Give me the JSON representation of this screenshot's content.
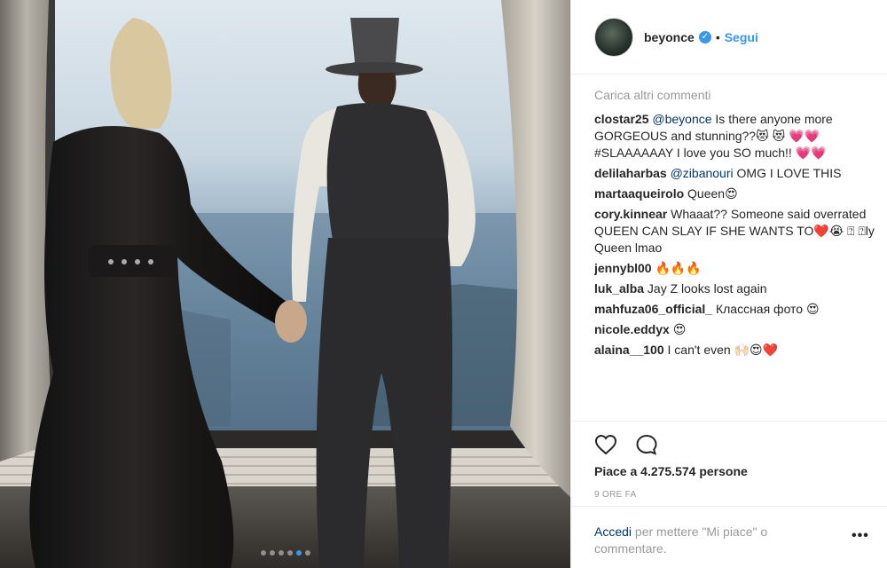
{
  "post": {
    "username": "beyonce",
    "separator": "•",
    "follow_label": "Segui",
    "load_more": "Carica altri commenti",
    "comments": [
      {
        "user": "clostar25",
        "mention": "@beyonce",
        "text": " Is there anyone more GORGEOUS and stunning??😻 😻 💗💗 #SLAAAAAAY I love you SO much!! 💗💗"
      },
      {
        "user": "delilaharbas",
        "mention": "@zibanouri",
        "text": " OMG I LOVE THIS"
      },
      {
        "user": "martaaqueirolo",
        "mention": "",
        "text": "Queen😍"
      },
      {
        "user": "cory.kinnear",
        "mention": "",
        "text": "Whaaat?? Someone said overrated QUEEN CAN SLAY IF SHE WANTS TO❤️😭 ⍰ ⍰ly Queen lmao"
      },
      {
        "user": "jennybl00",
        "mention": "",
        "text": "🔥🔥🔥"
      },
      {
        "user": "luk_alba",
        "mention": "",
        "text": "Jay Z looks lost again"
      },
      {
        "user": "mahfuza06_official_",
        "mention": "",
        "text": "Классная фото 😍"
      },
      {
        "user": "nicole.eddyx",
        "mention": "",
        "text": "😍"
      },
      {
        "user": "alaina__100",
        "mention": "",
        "text": "I can't even 🙌🏻😍❤️"
      }
    ],
    "likes": "Piace a 4.275.574 persone",
    "time": "9 ORE FA",
    "login_link": "Accedi",
    "login_text": " per mettere \"Mi piace\" o commentare.",
    "more_label": "•••",
    "carousel": {
      "count": 6,
      "active": 4
    }
  },
  "icons": {
    "like": "heart-icon",
    "comment": "comment-icon",
    "verified": "verified-badge-icon"
  },
  "colors": {
    "accent": "#3897f0",
    "link": "#003569",
    "muted": "#999999"
  }
}
